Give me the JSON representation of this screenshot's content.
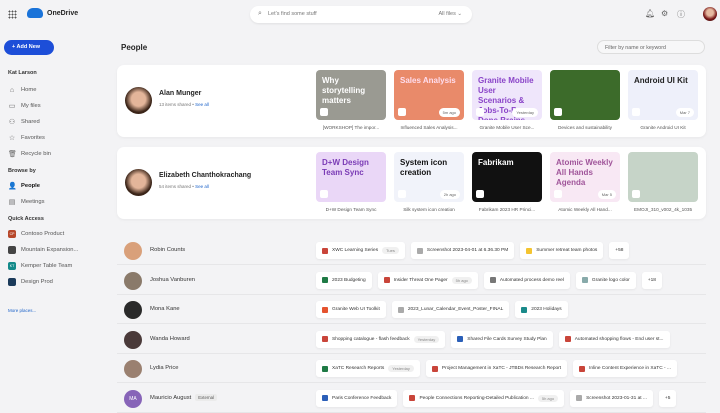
{
  "app": {
    "name": "OneDrive"
  },
  "search": {
    "placeholder": "Let's find some stuff",
    "scope": "All files"
  },
  "sidebar": {
    "add_new": "Add New",
    "user": "Kat Larson",
    "items": [
      {
        "label": "Home",
        "icon": "home-icon",
        "g": "⌂"
      },
      {
        "label": "My files",
        "icon": "folder-icon",
        "g": "▭"
      },
      {
        "label": "Shared",
        "icon": "shared-icon",
        "g": "⚇"
      },
      {
        "label": "Favorites",
        "icon": "star-icon",
        "g": "☆"
      },
      {
        "label": "Recycle bin",
        "icon": "trash-icon",
        "g": "🗑"
      }
    ],
    "browse_heading": "Browse by",
    "browse": [
      {
        "label": "People",
        "icon": "person-icon",
        "g": "👤",
        "active": true
      },
      {
        "label": "Meetings",
        "icon": "calendar-icon",
        "g": "▤"
      }
    ],
    "quick_heading": "Quick Access",
    "quick": [
      {
        "label": "Contoso Product",
        "abbr": "CP",
        "color": "#b7472a"
      },
      {
        "label": "Mountain Expansion...",
        "abbr": "",
        "color": "#444"
      },
      {
        "label": "Kemper Table Team",
        "abbr": "KT",
        "color": "#138a8a"
      },
      {
        "label": "Design Prod",
        "abbr": "",
        "color": "#1b3a5a"
      }
    ],
    "more": "More places..."
  },
  "main": {
    "title": "People",
    "filter_placeholder": "Filter by name or keyword",
    "featured": [
      {
        "name": "Alan Munger",
        "count": "13 items shared",
        "see_all": "See all",
        "files": [
          {
            "title": "Why storytelling matters",
            "caption": "[WORKSHOP] The impor...",
            "bg": "#9a9a92",
            "fg": "#fff",
            "badge": ""
          },
          {
            "title": "Sales Analysis",
            "caption": "Influenced Sales Analysis...",
            "bg": "#e98a6a",
            "fg": "#fde",
            "badge": "5m ago"
          },
          {
            "title": "Granite Mobile User Scenarios & Jobs-To-Be-Done Brains...",
            "caption": "Granite Mobile User Sce...",
            "bg": "#efe6fb",
            "fg": "#8a44c8",
            "badge": "Yesterday"
          },
          {
            "title": "",
            "caption": "Devices and sustainability",
            "bg": "#3c6b2a",
            "fg": "#fff",
            "badge": ""
          },
          {
            "title": "Android UI Kit",
            "caption": "Granite Android UI Kit",
            "bg": "#eef0fa",
            "fg": "#222",
            "badge": "Mar 7"
          }
        ]
      },
      {
        "name": "Elizabeth Chanthokrachang",
        "count": "54 items shared",
        "see_all": "See all",
        "files": [
          {
            "title": "D+W Design Team Sync",
            "caption": "D+W Design Team Sync",
            "bg": "#ead7f7",
            "fg": "#7a3bb5",
            "badge": ""
          },
          {
            "title": "System icon creation",
            "caption": "Silk system icon creation",
            "bg": "#f1f3fa",
            "fg": "#111",
            "badge": "2h ago"
          },
          {
            "title": "Fabrikam",
            "caption": "Fabrikam 2023 HR Princi...",
            "bg": "#111",
            "fg": "#fff",
            "badge": ""
          },
          {
            "title": "Atomic Weekly All Hands Agenda",
            "caption": "Atomic Weekly All Hand...",
            "bg": "#f8e8f4",
            "fg": "#a0559a",
            "badge": "Mar 5"
          },
          {
            "title": "",
            "caption": "EMOJI_310_v002_4k_1035",
            "bg": "#c6d4c8",
            "fg": "#fff",
            "badge": ""
          }
        ]
      }
    ],
    "people": [
      {
        "name": "Robin Counts",
        "initials": "",
        "av": "#d9a07a",
        "external": "",
        "files": [
          {
            "t": "XWC Learning Series",
            "c": "#c9453a",
            "b": "Tues"
          },
          {
            "t": "Screenshot 2023-04-01 at 6.36.30 PM",
            "c": "#aaa",
            "b": ""
          },
          {
            "t": "Summer retreat team photos",
            "c": "#f4c430",
            "b": ""
          }
        ],
        "more": "+58"
      },
      {
        "name": "Joshua Vanburen",
        "initials": "",
        "av": "#8a7a6a",
        "external": "",
        "files": [
          {
            "t": "2023 Budgeting",
            "c": "#1f7a45",
            "b": ""
          },
          {
            "t": "Insider Threat One Pager",
            "c": "#c9453a",
            "b": "5h ago"
          },
          {
            "t": "Automated process demo reel",
            "c": "#777",
            "b": ""
          },
          {
            "t": "Granite logo color",
            "c": "#8aa",
            "b": ""
          }
        ],
        "more": "+18"
      },
      {
        "name": "Mona Kane",
        "initials": "",
        "av": "#2a2a2a",
        "external": "",
        "files": [
          {
            "t": "Granite Web UI Toolkit",
            "c": "#e5532f",
            "b": ""
          },
          {
            "t": "2023_Lunar_Calendar_Event_Poster_FINAL",
            "c": "#aaa",
            "b": ""
          },
          {
            "t": "2023 Holidays",
            "c": "#1a8a8a",
            "b": ""
          }
        ],
        "more": ""
      },
      {
        "name": "Wanda Howard",
        "initials": "",
        "av": "#4a3a3a",
        "external": "",
        "files": [
          {
            "t": "Shopping catalogue - flash feedback",
            "c": "#c9453a",
            "b": "Yesterday"
          },
          {
            "t": "Shared File Cards Survey Study Plan",
            "c": "#2b5fb8",
            "b": ""
          },
          {
            "t": "Automated shopping flows - End user st...",
            "c": "#c9453a",
            "b": ""
          }
        ],
        "more": ""
      },
      {
        "name": "Lydia Price",
        "initials": "",
        "av": "#9a8070",
        "external": "",
        "files": [
          {
            "t": "XaTC Research Reports",
            "c": "#1f7a45",
            "b": "Yesterday"
          },
          {
            "t": "Project Management in XaTC - JTBDs Research Report",
            "c": "#c9453a",
            "b": ""
          },
          {
            "t": "Inline Content Experience in XaTC - ...",
            "c": "#c9453a",
            "b": ""
          }
        ],
        "more": ""
      },
      {
        "name": "Mauricio August",
        "initials": "MA",
        "av": "#8764b8",
        "external": "External",
        "files": [
          {
            "t": "Paris Conference Feedback",
            "c": "#2b5fb8",
            "b": ""
          },
          {
            "t": "People Connections Reporting-Detailed Publication ...",
            "c": "#c9453a",
            "b": "5h ago"
          },
          {
            "t": "Screenshot 2023-01-31 at ...",
            "c": "#aaa",
            "b": ""
          }
        ],
        "more": "+5"
      }
    ]
  }
}
